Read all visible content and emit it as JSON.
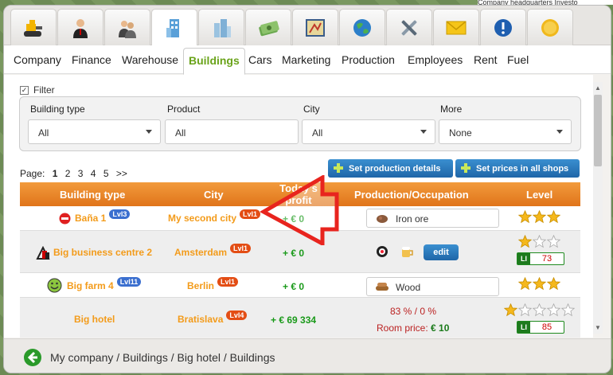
{
  "top_strip_text": "Company headquarters Investo",
  "icon_tabs": [
    {
      "icon": "bulldozer-icon",
      "active": false
    },
    {
      "icon": "businessman-icon",
      "active": false
    },
    {
      "icon": "employees-icon",
      "active": false
    },
    {
      "icon": "building-icon",
      "active": true
    },
    {
      "icon": "skyscrapers-icon",
      "active": false
    },
    {
      "icon": "money-icon",
      "active": false
    },
    {
      "icon": "map-icon",
      "active": false
    },
    {
      "icon": "globe-icon",
      "active": false
    },
    {
      "icon": "tools-icon",
      "active": false
    },
    {
      "icon": "envelope-icon",
      "active": false
    },
    {
      "icon": "info-icon",
      "active": false
    },
    {
      "icon": "coin-icon",
      "active": false
    }
  ],
  "nav_tabs": [
    "Company",
    "Finance",
    "Warehouse",
    "Buildings",
    "Cars",
    "Marketing",
    "Production",
    "Employees",
    "Rent",
    "Fuel"
  ],
  "nav_active": "Buildings",
  "filter": {
    "label": "Filter",
    "checked": true,
    "fields": [
      {
        "label": "Building type",
        "value": "All"
      },
      {
        "label": "Product",
        "value": "All"
      },
      {
        "label": "City",
        "value": "All"
      },
      {
        "label": "More",
        "value": "None"
      }
    ]
  },
  "pager": {
    "label": "Page:",
    "current": "1",
    "pages": [
      "2",
      "3",
      "4",
      "5"
    ],
    "next": ">>"
  },
  "buttons": {
    "set_production": "Set production details",
    "set_prices": "Set prices in all shops",
    "edit": "edit"
  },
  "table": {
    "headers": [
      "Building type",
      "City",
      "Today's profit",
      "Production/Occupation",
      "Level"
    ],
    "rows": [
      {
        "name": "Baña 1",
        "badge": "Lvl3",
        "city": "My second city",
        "city_badge": "Lvl1",
        "profit": "+ € 0",
        "production": "Iron ore",
        "prod_icon": "iron-ore-icon",
        "stars": 3
      },
      {
        "name": "Big business centre 2",
        "city": "Amsterdam",
        "city_badge": "Lvl1",
        "profit": "+ € 0",
        "stars": 1,
        "level": "73"
      },
      {
        "name": "Big farm 4",
        "badge": "Lvl11",
        "city": "Berlin",
        "city_badge": "Lvl1",
        "profit": "+ € 0",
        "production": "Wood",
        "prod_icon": "wood-icon",
        "stars": 3
      },
      {
        "name": "Big hotel",
        "city": "Bratislava",
        "city_badge": "Lvl4",
        "profit": "+ € 69 334",
        "occupation": "83 % / 0 %",
        "room_price_label": "Room price:",
        "room_price": "€ 10",
        "stars": 1,
        "level": "85"
      }
    ],
    "license_label": "LI"
  },
  "breadcrumb": "My company / Buildings / Big hotel / Buildings",
  "colors": {
    "accent_green": "#6aa31a",
    "header_orange": "#e0741a",
    "button_blue": "#1f66a8",
    "arrow_red": "#e8241e"
  }
}
